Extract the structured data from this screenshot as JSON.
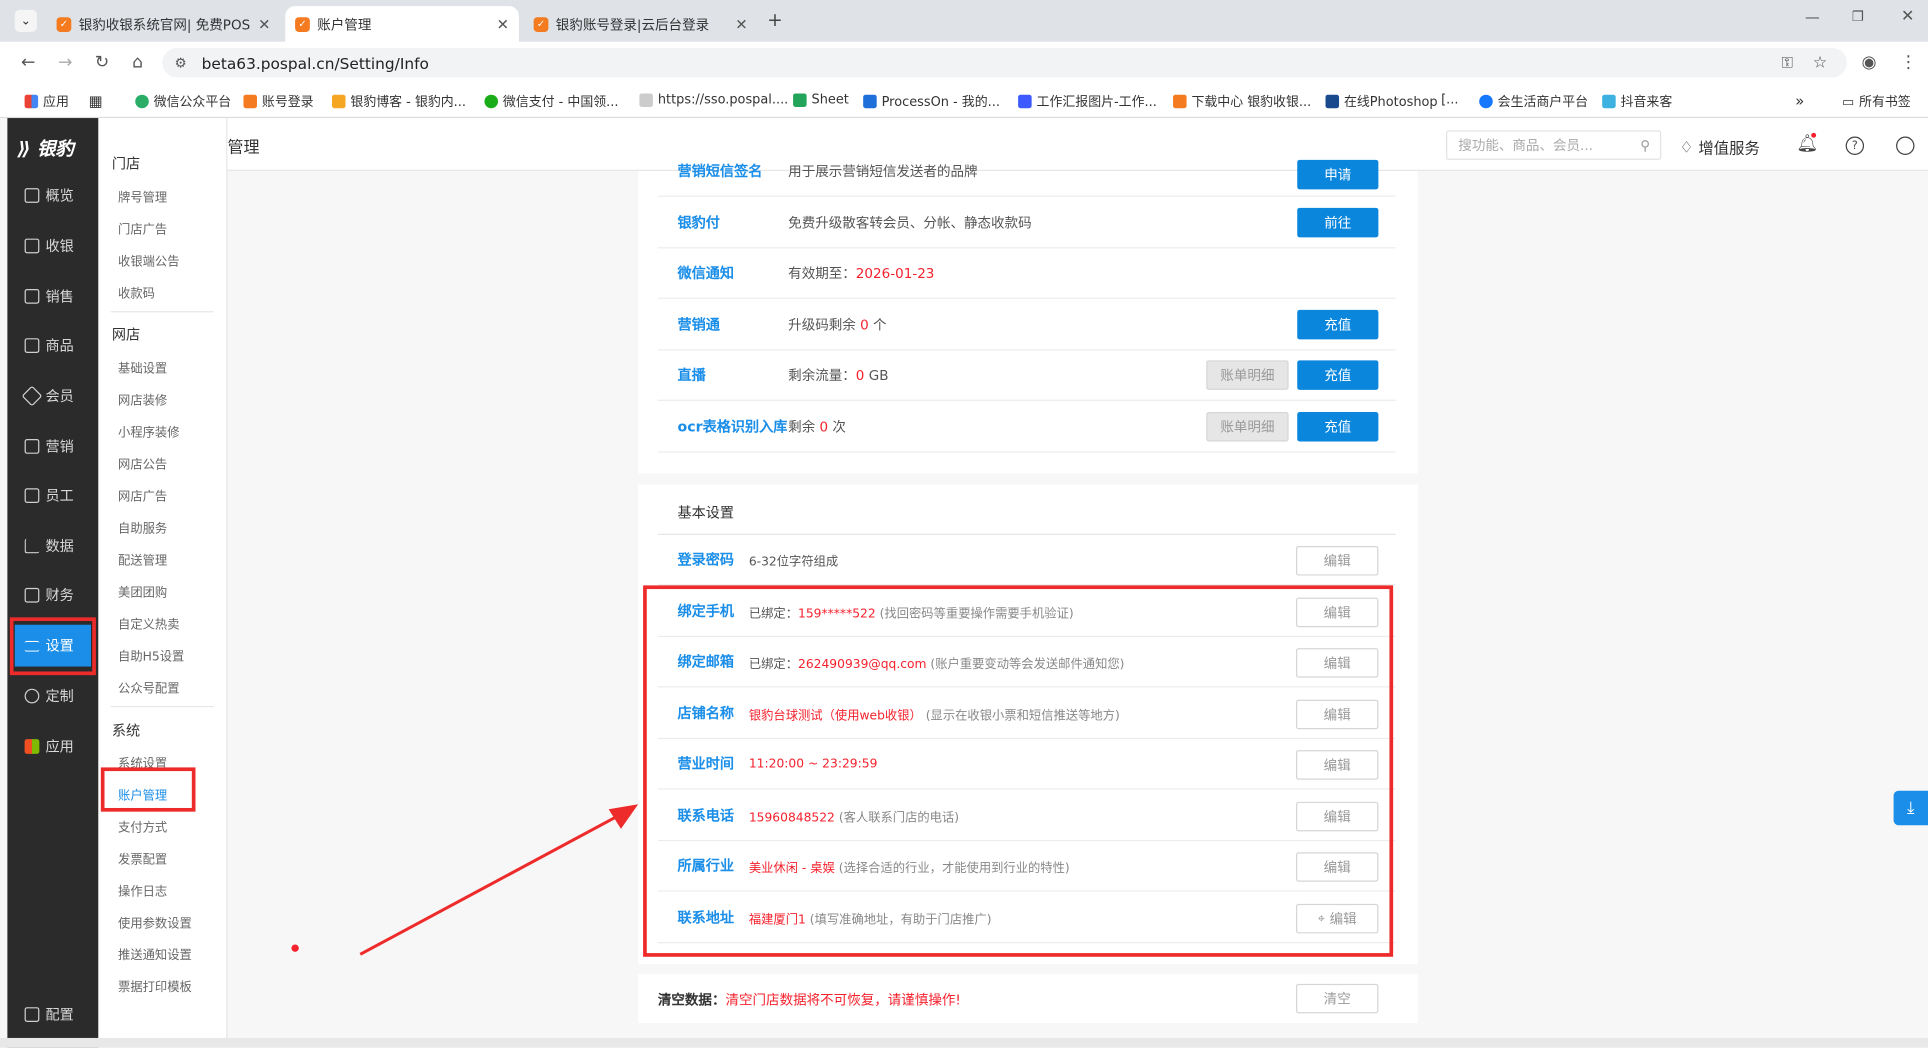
{
  "browser": {
    "tabs": [
      {
        "title": "银豹收银系统官网| 免费POS收银",
        "active": false
      },
      {
        "title": "账户管理",
        "active": true
      },
      {
        "title": "银豹账号登录|云后台登录",
        "active": false
      }
    ],
    "url": "beta63.pospal.cn/Setting/Info",
    "bookmarks": [
      "应用",
      "微信公众平台",
      "账号登录",
      "银豹博客 - 银豹内...",
      "微信支付 - 中国领...",
      "https://sso.pospal....",
      "Sheet",
      "ProcessOn - 我的...",
      "工作汇报图片-工作...",
      "下载中心 银豹收银...",
      "在线Photoshop",
      "[...",
      "会生活商户平台",
      "抖音来客",
      "所有书签"
    ]
  },
  "sidebar": {
    "logo": "银豹",
    "items": [
      {
        "label": "概览",
        "icon": "home-icon"
      },
      {
        "label": "收银",
        "icon": "cashier-icon"
      },
      {
        "label": "销售",
        "icon": "sales-icon"
      },
      {
        "label": "商品",
        "icon": "goods-icon"
      },
      {
        "label": "会员",
        "icon": "member-icon"
      },
      {
        "label": "营销",
        "icon": "marketing-icon"
      },
      {
        "label": "员工",
        "icon": "staff-icon"
      },
      {
        "label": "数据",
        "icon": "chart-icon"
      },
      {
        "label": "财务",
        "icon": "finance-icon"
      },
      {
        "label": "设置",
        "icon": "settings-icon",
        "active": true
      },
      {
        "label": "定制",
        "icon": "custom-icon"
      },
      {
        "label": "应用",
        "icon": "apps-icon"
      }
    ],
    "bottom": "配置"
  },
  "subnav": {
    "groups": [
      {
        "title": "门店",
        "items": [
          "牌号管理",
          "门店广告",
          "收银端公告",
          "收款码"
        ]
      },
      {
        "title": "网店",
        "items": [
          "基础设置",
          "网店装修",
          "小程序装修",
          "网店公告",
          "网店广告",
          "自助服务",
          "配送管理",
          "美团团购",
          "自定义热卖",
          "自助H5设置",
          "公众号配置"
        ]
      },
      {
        "title": "系统",
        "items": [
          "系统设置",
          "账户管理",
          "支付方式",
          "发票配置",
          "操作日志",
          "使用参数设置",
          "推送通知设置",
          "票据打印模板"
        ]
      }
    ],
    "active": "账户管理"
  },
  "header": {
    "breadcrumb": "管理",
    "search_placeholder": "搜功能、商品、会员...",
    "value_service": "增值服务"
  },
  "services": [
    {
      "label": "营销短信签名",
      "desc": "用于展示营销短信发送者的品牌",
      "button": "申请"
    },
    {
      "label": "银豹付",
      "desc": "免费升级散客转会员、分帐、静态收款码",
      "button": "前往"
    },
    {
      "label": "微信通知",
      "desc_prefix": "有效期至：",
      "desc_value": "2026-01-23"
    },
    {
      "label": "营销通",
      "desc_prefix": "升级码剩余 ",
      "desc_value": "0",
      "desc_suffix": " 个",
      "button": "充值"
    },
    {
      "label": "直播",
      "desc_prefix": "剩余流量：",
      "desc_value": "0",
      "desc_suffix": " GB",
      "detail": "账单明细",
      "button": "充值"
    },
    {
      "label": "ocr表格识别入库",
      "desc_prefix": "剩余 ",
      "desc_value": "0",
      "desc_suffix": " 次",
      "detail": "账单明细",
      "button": "充值"
    }
  ],
  "basic": {
    "title": "基本设置",
    "rows": [
      {
        "label": "登录密码",
        "value": "",
        "desc": "6-32位字符组成",
        "button": "编辑"
      },
      {
        "label": "绑定手机",
        "prefix": "已绑定：",
        "value": "159*****522",
        "desc": "(找回密码等重要操作需要手机验证)",
        "button": "编辑"
      },
      {
        "label": "绑定邮箱",
        "prefix": "已绑定：",
        "value": "262490939@qq.com",
        "desc": "(账户重要变动等会发送邮件通知您)",
        "button": "编辑"
      },
      {
        "label": "店铺名称",
        "prefix": "",
        "value": "银豹台球测试（使用web收银）",
        "desc": "(显示在收银小票和短信推送等地方)",
        "button": "编辑"
      },
      {
        "label": "营业时间",
        "prefix": "",
        "value": "11:20:00 ~ 23:29:59",
        "desc": "",
        "button": "编辑"
      },
      {
        "label": "联系电话",
        "prefix": "",
        "value": "15960848522",
        "desc": "(客人联系门店的电话)",
        "button": "编辑"
      },
      {
        "label": "所属行业",
        "prefix": "",
        "value": "美业休闲 - 桌娱",
        "desc": "(选择合适的行业，才能使用到行业的特性)",
        "button": "编辑"
      },
      {
        "label": "联系地址",
        "prefix": "",
        "value": "福建厦门1",
        "desc": "(填写准确地址，有助于门店推广)",
        "button": "编辑"
      }
    ]
  },
  "clear": {
    "label": "清空数据：",
    "warning": "清空门店数据将不可恢复，请谨慎操作!",
    "button": "清空"
  },
  "colors": {
    "accent": "#1a8ee8",
    "button_blue": "#0a86dc",
    "highlight": "#ee2b2b",
    "warning": "#f5222d",
    "sidebar": "#2b2b2b"
  }
}
